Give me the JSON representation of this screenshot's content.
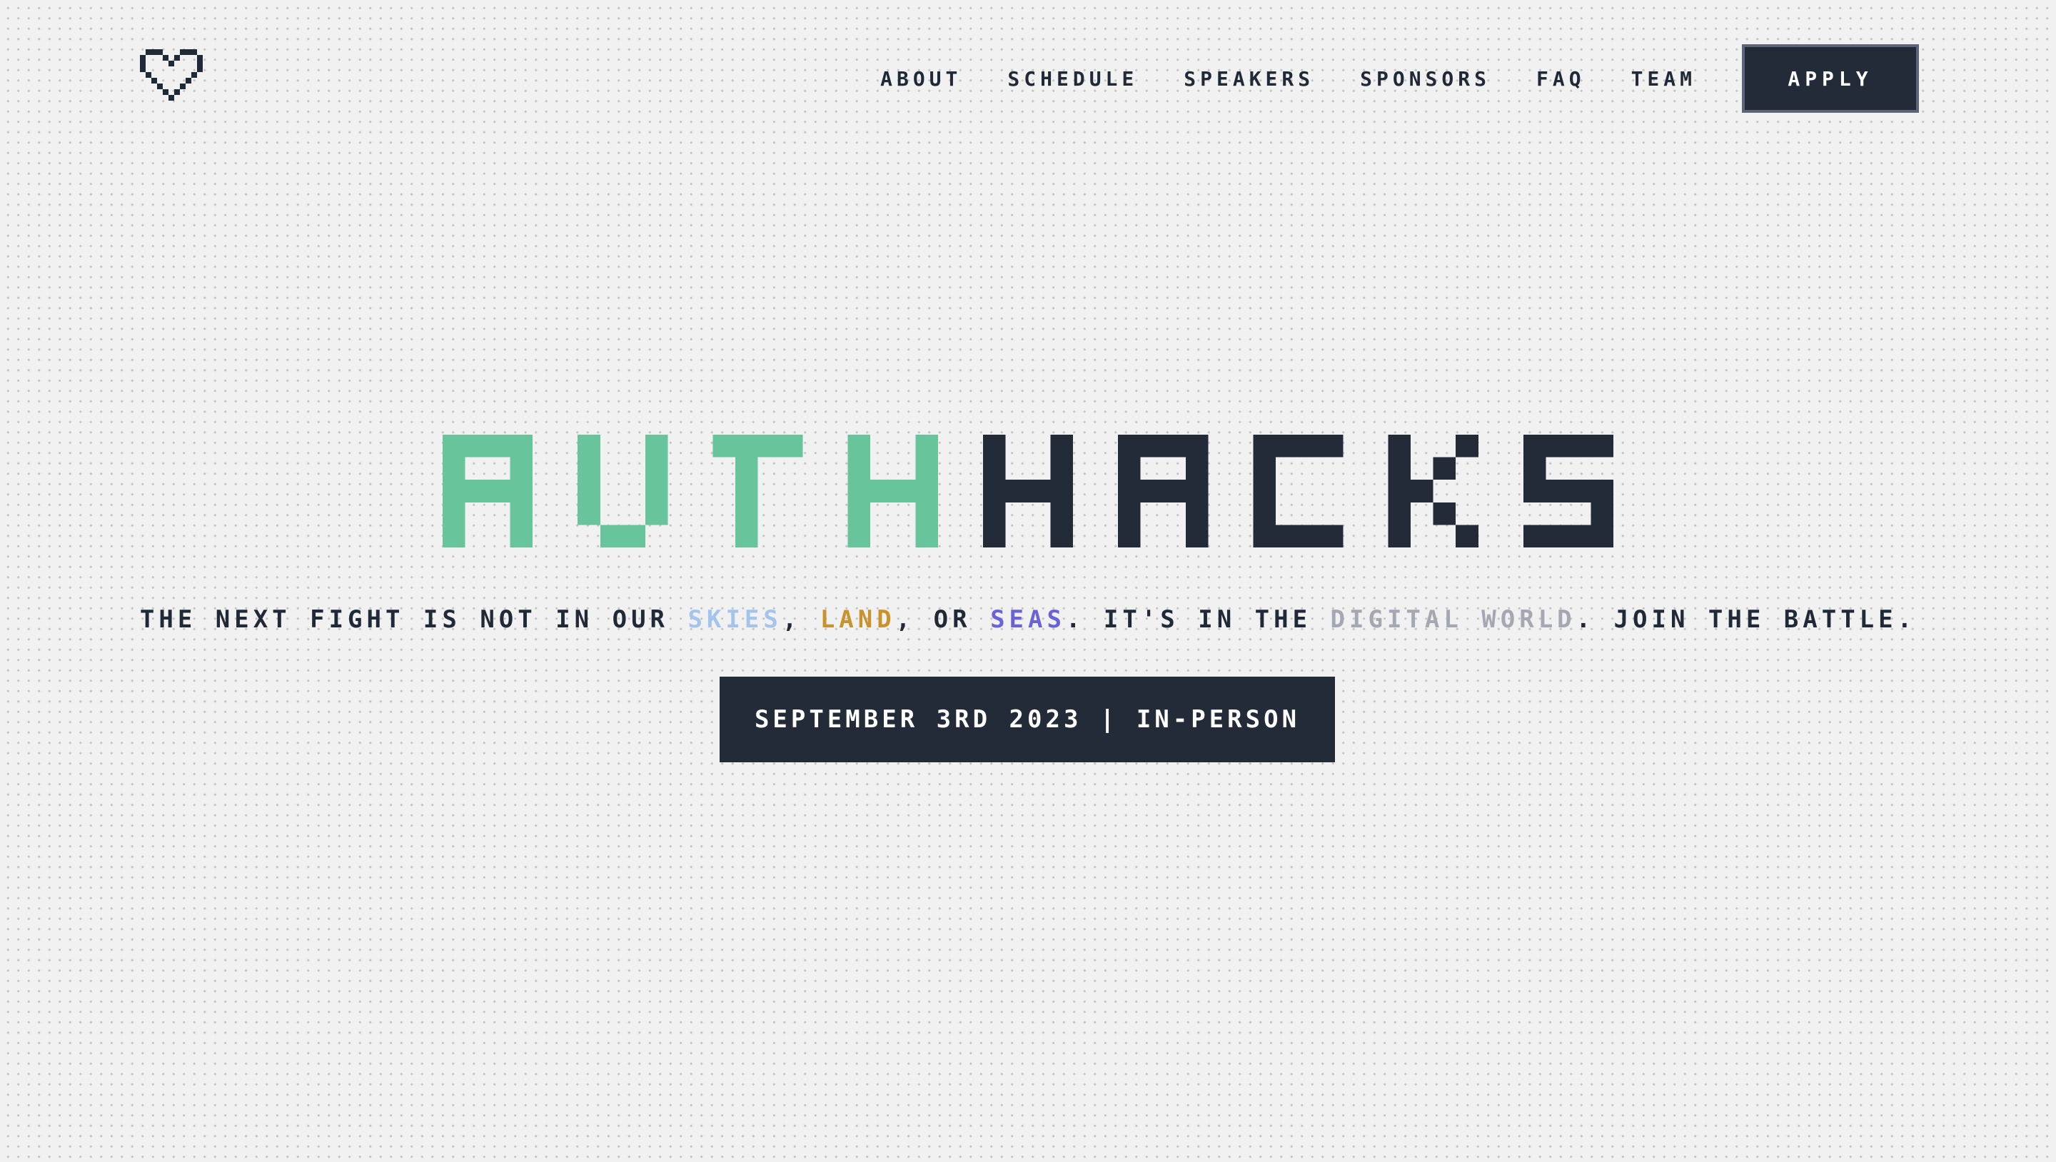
{
  "header": {
    "logo_icon": "pixel-heart-icon",
    "nav": [
      {
        "label": "About"
      },
      {
        "label": "Schedule"
      },
      {
        "label": "Speakers"
      },
      {
        "label": "Sponsors"
      },
      {
        "label": "FAQ"
      },
      {
        "label": "Team"
      }
    ],
    "apply_label": "Apply"
  },
  "hero": {
    "title_part1": "AUTH",
    "title_part2": "HACKS",
    "tagline": {
      "t1": "The next fight is not in our ",
      "skies": "skies",
      "t2": ", ",
      "land": "land",
      "t3": ", or ",
      "seas": "seas",
      "t4": ". It's in the ",
      "digital": "digital world",
      "t5": ". Join the battle."
    },
    "date_badge": "September 3rd 2023 | In-Person"
  },
  "colors": {
    "accent_green": "#67c49b",
    "dark": "#232a38",
    "skies": "#a5c4ec",
    "land": "#c9922a",
    "seas": "#6a63d8",
    "digital": "#a3a8b3"
  }
}
